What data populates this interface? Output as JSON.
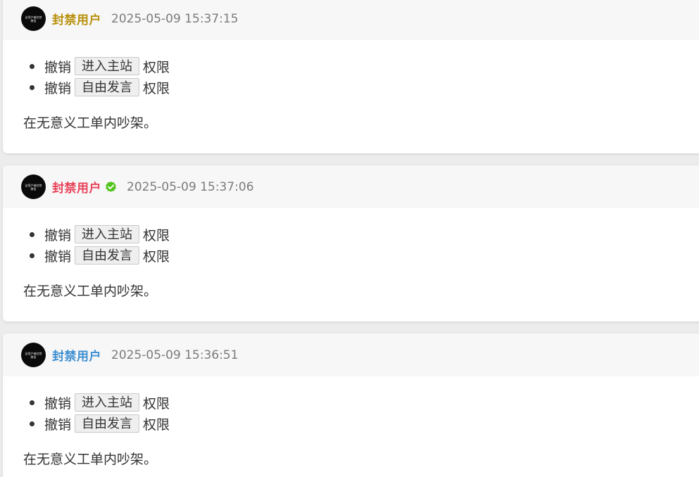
{
  "cards": [
    {
      "avatar_text": [
        "这用户被封禁",
        "微信"
      ],
      "username": "封禁用户",
      "username_color": "#b8900c",
      "verified": false,
      "timestamp": "2025-05-09 15:37:15",
      "revoke_prefix": "撤销",
      "perm_suffix": "权限",
      "permissions": [
        "进入主站",
        "自由发言"
      ],
      "reason": "在无意义工单内吵架。"
    },
    {
      "avatar_text": [
        "这用户被封禁",
        "微信"
      ],
      "username": "封禁用户",
      "username_color": "#e8445a",
      "verified": true,
      "verified_color": "#52c41a",
      "timestamp": "2025-05-09 15:37:06",
      "revoke_prefix": "撤销",
      "perm_suffix": "权限",
      "permissions": [
        "进入主站",
        "自由发言"
      ],
      "reason": "在无意义工单内吵架。"
    },
    {
      "avatar_text": [
        "这用户被封禁",
        "微信"
      ],
      "username": "封禁用户",
      "username_color": "#3d8fd1",
      "verified": false,
      "timestamp": "2025-05-09 15:36:51",
      "revoke_prefix": "撤销",
      "perm_suffix": "权限",
      "permissions": [
        "进入主站",
        "自由发言"
      ],
      "reason": "在无意义工单内吵架。"
    }
  ]
}
